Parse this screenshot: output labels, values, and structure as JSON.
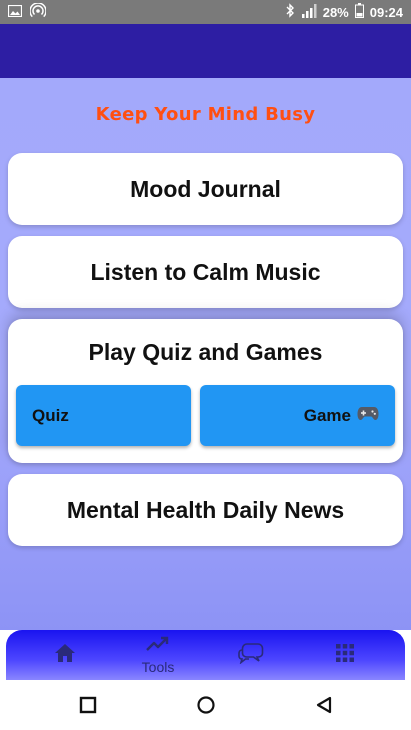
{
  "status_bar": {
    "battery": "28%",
    "time": "09:24",
    "icons": [
      "image-icon",
      "hotspot-icon",
      "bluetooth-icon",
      "signal-icon",
      "battery-icon"
    ]
  },
  "app_bar": {
    "color": "#2d1ea3"
  },
  "tagline": "Keep Your Mind Busy",
  "cards": {
    "journal": "Mood Journal",
    "music": "Listen to Calm Music",
    "games_title": "Play Quiz and Games",
    "quiz_button": "Quiz",
    "game_button": "Game",
    "news": "Mental Health Daily News"
  },
  "bottom_nav": {
    "tools_label": "Tools",
    "items": [
      "home-icon",
      "trending-up-icon",
      "chat-icon",
      "grid-menu-icon"
    ]
  },
  "colors": {
    "accent": "#ff4f12",
    "button": "#2196f3",
    "nav": "#1a14f0",
    "background": "#a3a9fb"
  }
}
